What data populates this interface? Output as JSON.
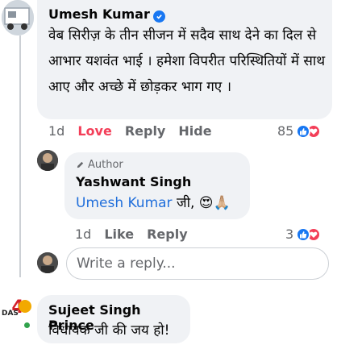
{
  "comment1": {
    "author": "Umesh Kumar",
    "text": "वेब सिरीज़ के तीन सीजन में सदैव साथ देने का दिल से आभार यशवंत भाई । हमेशा विपरीत परिस्थितियों में साथ आए और अच्छे में छोड़कर भाग गए ।",
    "time": "1d",
    "love_label": "Love",
    "reply_label": "Reply",
    "hide_label": "Hide",
    "reaction_count": "85"
  },
  "reply1": {
    "badge": "Author",
    "author": "Yashwant Singh",
    "mention": "Umesh Kumar",
    "text_after": " जी, 😍🙏🏼",
    "time": "1d",
    "like_label": "Like",
    "reply_label": "Reply",
    "reaction_count": "3"
  },
  "reply_box": {
    "placeholder": "Write a reply..."
  },
  "comment2": {
    "author": "Sujeet Singh Prince",
    "text": "विधायक जी की जय हो!",
    "avatar_text": "DAS"
  },
  "colors": {
    "link_blue": "#216fdb",
    "love_red": "#f33e58",
    "like_blue": "#1877f2",
    "bubble_gray": "#f0f2f5",
    "meta_gray": "#65676b"
  }
}
